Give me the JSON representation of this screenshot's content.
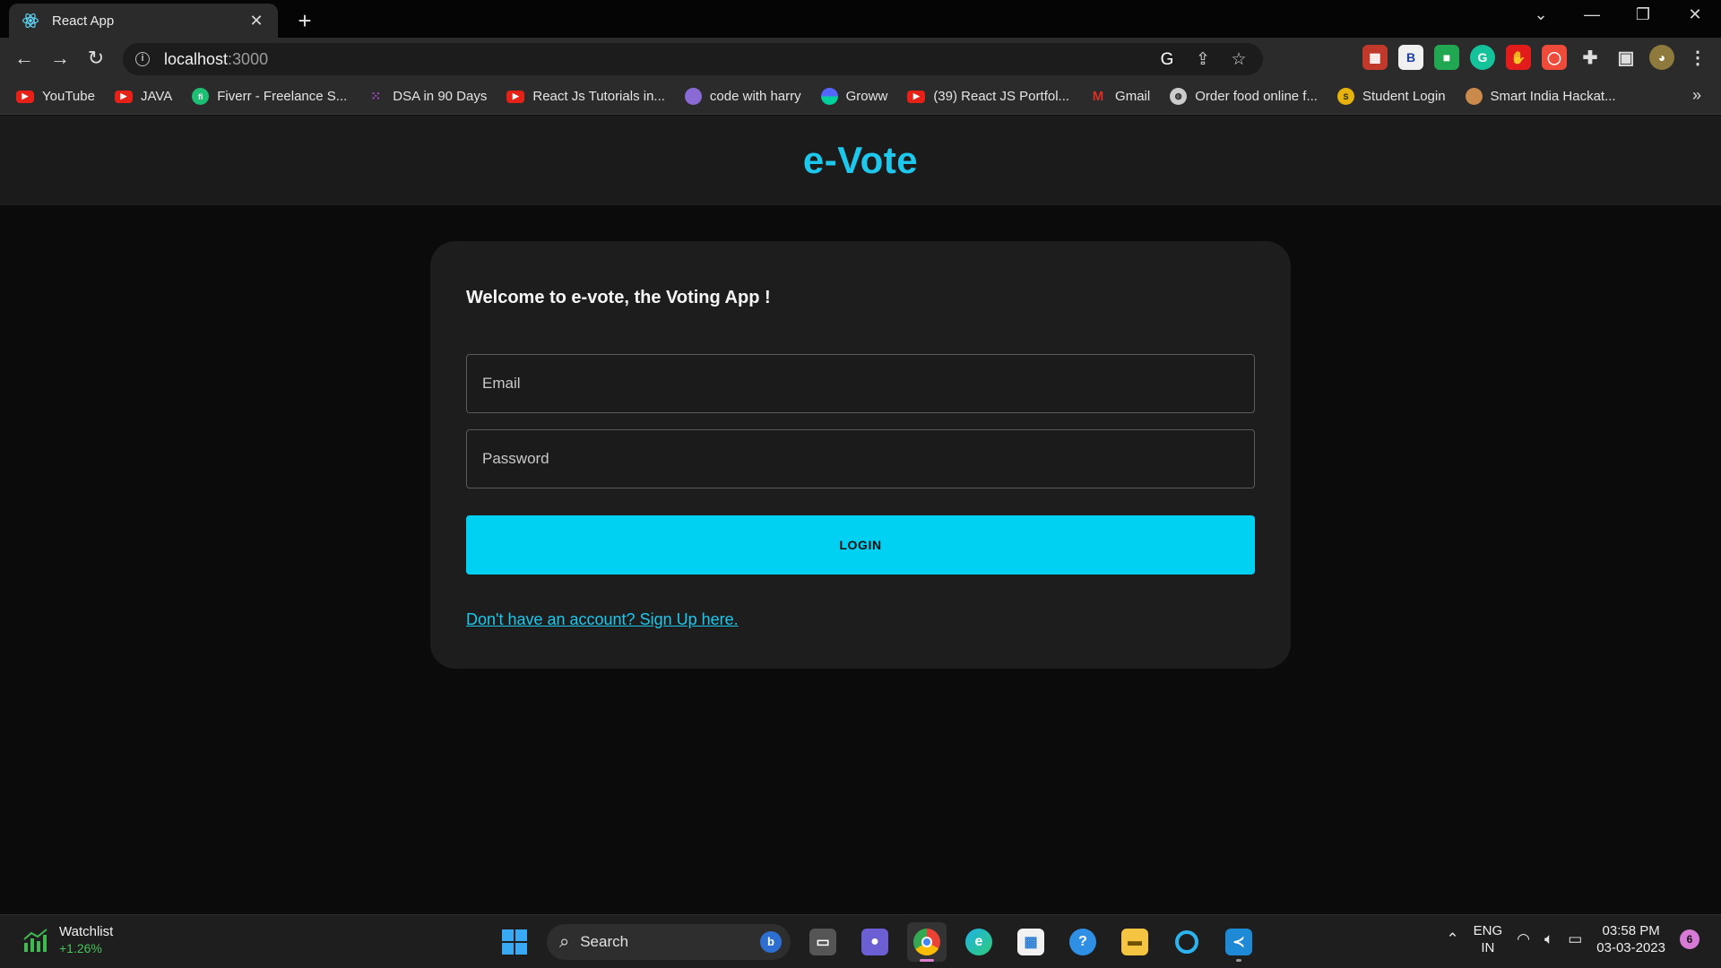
{
  "browser": {
    "tab_title": "React App",
    "url_host": "localhost",
    "url_port": ":3000",
    "bookmarks": [
      {
        "label": "YouTube",
        "icon": "youtube-icon",
        "color": "#e62117"
      },
      {
        "label": "JAVA",
        "icon": "youtube-icon",
        "color": "#e62117"
      },
      {
        "label": "Fiverr - Freelance S...",
        "icon": "fiverr-icon",
        "color": "#1dbf73"
      },
      {
        "label": "DSA in 90 Days",
        "icon": "dsa-icon",
        "color": "#b04ad8"
      },
      {
        "label": "React Js Tutorials in...",
        "icon": "youtube-icon",
        "color": "#e62117"
      },
      {
        "label": "code with harry",
        "icon": "avatar-icon",
        "color": "#8a6bd6"
      },
      {
        "label": "Groww",
        "icon": "groww-icon",
        "color": "#5367ff"
      },
      {
        "label": "(39) React JS Portfol...",
        "icon": "youtube-icon",
        "color": "#e62117"
      },
      {
        "label": "Gmail",
        "icon": "gmail-icon",
        "color": "#d93025"
      },
      {
        "label": "Order food online f...",
        "icon": "globe-icon",
        "color": "#cccccc"
      },
      {
        "label": "Student Login",
        "icon": "student-icon",
        "color": "#e5b20e"
      },
      {
        "label": "Smart India Hackat...",
        "icon": "bulb-icon",
        "color": "#c98a4b"
      }
    ],
    "more_bookmarks": "»"
  },
  "app": {
    "logo": "e-Vote",
    "welcome": "Welcome to e-vote, the Voting App !",
    "email_placeholder": "Email",
    "password_placeholder": "Password",
    "login_label": "LOGIN",
    "signup_link": "Don't have an account? Sign Up here.",
    "accent_color": "#00d1f3"
  },
  "taskbar": {
    "watchlist_title": "Watchlist",
    "watchlist_change": "+1.26%",
    "search_label": "Search",
    "language": "ENG",
    "region": "IN",
    "time": "03:58 PM",
    "date": "03-03-2023",
    "notification_count": "6"
  }
}
